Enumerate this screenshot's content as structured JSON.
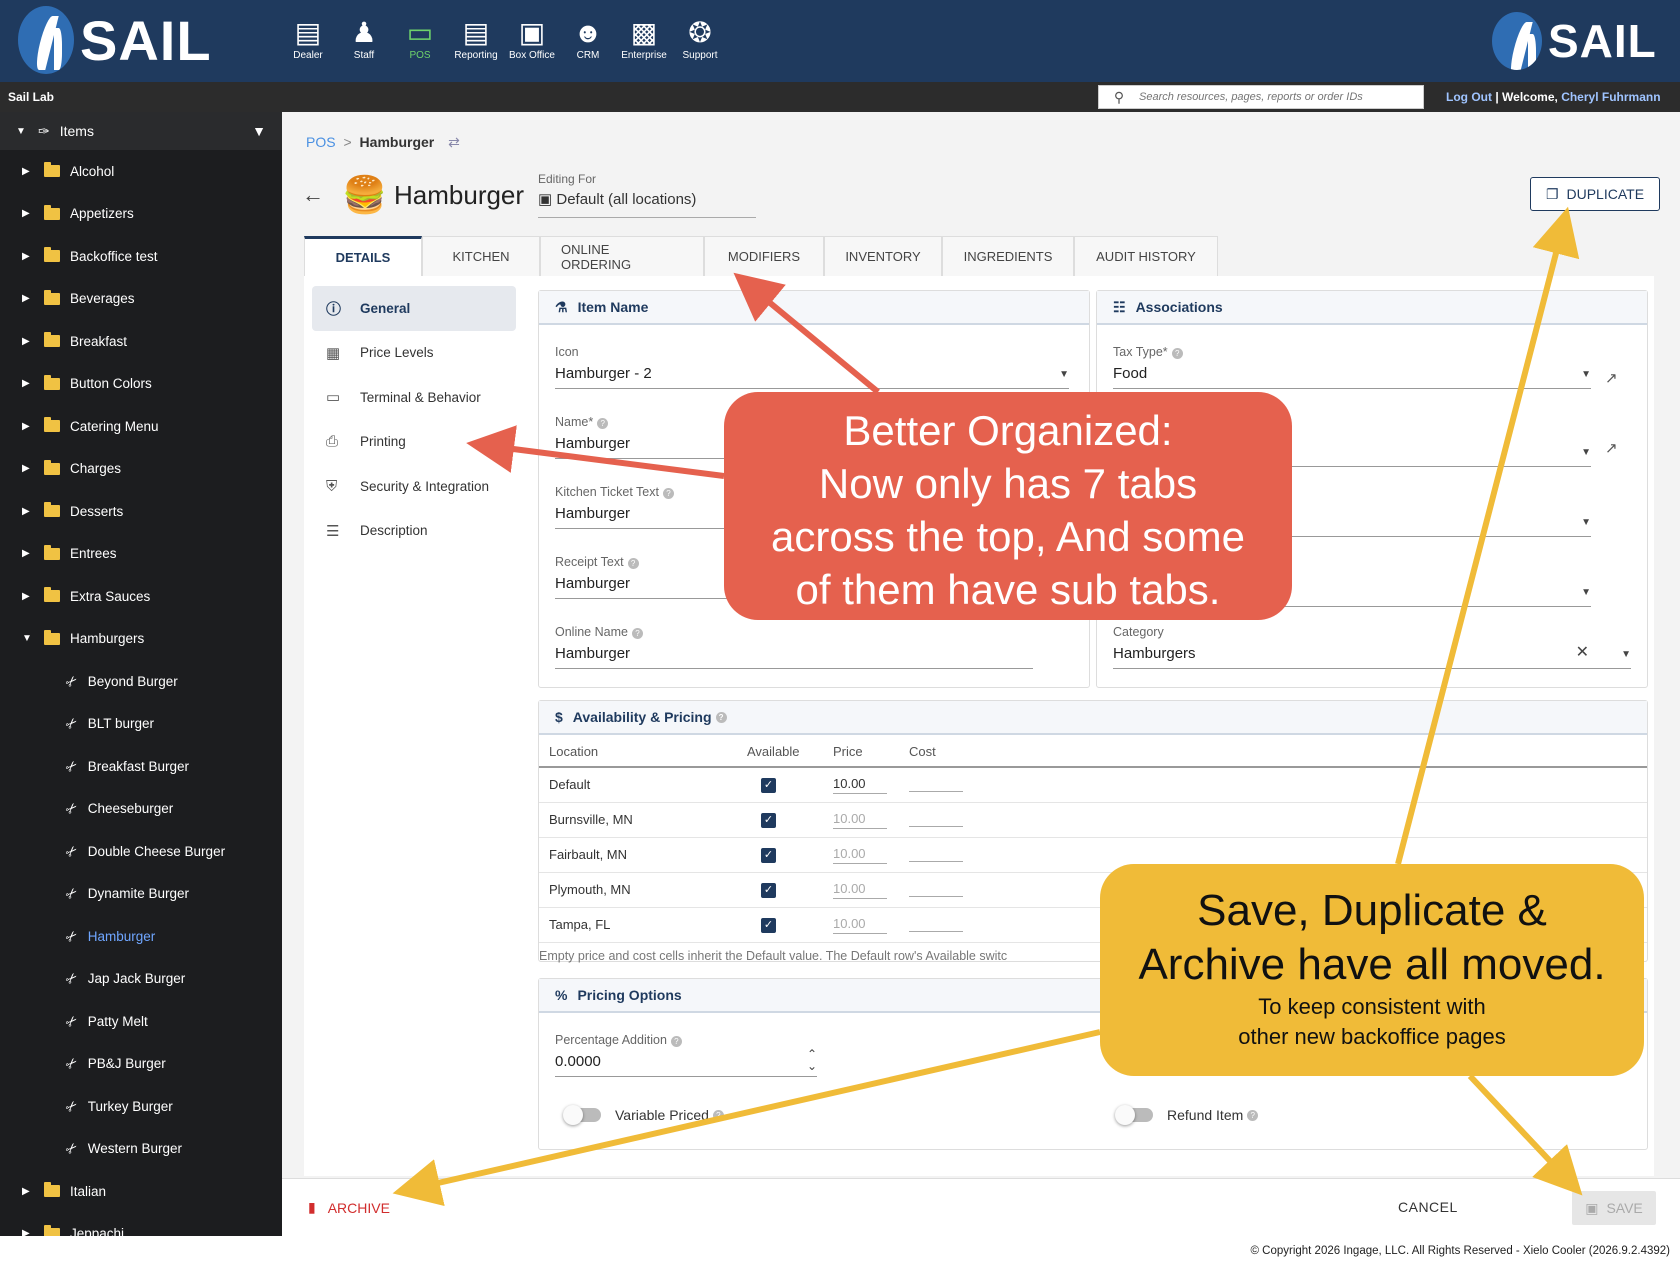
{
  "header": {
    "brand": "SAIL",
    "modules": [
      {
        "label": "Dealer",
        "icon": "dealer-icon"
      },
      {
        "label": "Staff",
        "icon": "staff-icon"
      },
      {
        "label": "POS",
        "icon": "pos-icon",
        "active": true
      },
      {
        "label": "Reporting",
        "icon": "reporting-icon"
      },
      {
        "label": "Box Office",
        "icon": "box-office-icon"
      },
      {
        "label": "CRM",
        "icon": "crm-icon"
      },
      {
        "label": "Enterprise",
        "icon": "enterprise-icon"
      },
      {
        "label": "Support",
        "icon": "support-icon"
      }
    ]
  },
  "subbar": {
    "location": "Sail Lab",
    "search_placeholder": "Search resources, pages, reports or order IDs",
    "logout": "Log Out",
    "welcome": "Welcome,",
    "user": "Cheryl Fuhrmann"
  },
  "sidebar": {
    "root": "Items",
    "items": [
      {
        "label": "Alcohol",
        "type": "folder"
      },
      {
        "label": "Appetizers",
        "type": "folder"
      },
      {
        "label": "Backoffice test",
        "type": "folder"
      },
      {
        "label": "Beverages",
        "type": "folder"
      },
      {
        "label": "Breakfast",
        "type": "folder"
      },
      {
        "label": "Button Colors",
        "type": "folder"
      },
      {
        "label": "Catering Menu",
        "type": "folder"
      },
      {
        "label": "Charges",
        "type": "folder"
      },
      {
        "label": "Desserts",
        "type": "folder"
      },
      {
        "label": "Entrees",
        "type": "folder"
      },
      {
        "label": "Extra Sauces",
        "type": "folder"
      },
      {
        "label": "Hamburgers",
        "type": "folder",
        "open": true
      },
      {
        "label": "Beyond Burger",
        "type": "item"
      },
      {
        "label": "BLT burger",
        "type": "item"
      },
      {
        "label": "Breakfast Burger",
        "type": "item"
      },
      {
        "label": "Cheeseburger",
        "type": "item"
      },
      {
        "label": "Double Cheese Burger",
        "type": "item"
      },
      {
        "label": "Dynamite Burger",
        "type": "item"
      },
      {
        "label": "Hamburger",
        "type": "item",
        "selected": true
      },
      {
        "label": "Jap Jack Burger",
        "type": "item"
      },
      {
        "label": "Patty Melt",
        "type": "item"
      },
      {
        "label": "PB&J Burger",
        "type": "item"
      },
      {
        "label": "Turkey Burger",
        "type": "item"
      },
      {
        "label": "Western Burger",
        "type": "item"
      },
      {
        "label": "Italian",
        "type": "folder"
      },
      {
        "label": "Jeppachi",
        "type": "folder"
      }
    ]
  },
  "breadcrumb": {
    "root": "POS",
    "sep": ">",
    "current": "Hamburger"
  },
  "title": "Hamburger",
  "editing": {
    "label": "Editing For",
    "value": "Default (all locations)"
  },
  "duplicate_label": "DUPLICATE",
  "tabs": [
    "DETAILS",
    "KITCHEN",
    "ONLINE ORDERING",
    "MODIFIERS",
    "INVENTORY",
    "INGREDIENTS",
    "AUDIT HISTORY"
  ],
  "subnav": [
    {
      "label": "General",
      "icon": "info-icon",
      "active": true
    },
    {
      "label": "Price Levels",
      "icon": "price-levels-icon"
    },
    {
      "label": "Terminal & Behavior",
      "icon": "monitor-icon"
    },
    {
      "label": "Printing",
      "icon": "printer-icon"
    },
    {
      "label": "Security & Integration",
      "icon": "shield-icon"
    },
    {
      "label": "Description",
      "icon": "lines-icon"
    }
  ],
  "item_name": {
    "title": "Item Name",
    "icon_label": "Icon",
    "icon_value": "Hamburger - 2",
    "name_label": "Name*",
    "name_value": "Hamburger",
    "kitchen_label": "Kitchen Ticket Text",
    "kitchen_value": "Hamburger",
    "receipt_label": "Receipt Text",
    "receipt_value": "Hamburger",
    "online_label": "Online Name",
    "online_value": "Hamburger"
  },
  "associations": {
    "title": "Associations",
    "tax_label": "Tax Type*",
    "tax_value": "Food",
    "category_label": "Category",
    "category_value": "Hamburgers"
  },
  "availability": {
    "title": "Availability & Pricing",
    "headers": [
      "Location",
      "Available",
      "Price",
      "Cost"
    ],
    "rows": [
      {
        "location": "Default",
        "available": true,
        "price": "10.00",
        "dim": false
      },
      {
        "location": "Burnsville, MN",
        "available": true,
        "price": "10.00",
        "dim": true
      },
      {
        "location": "Fairbault, MN",
        "available": true,
        "price": "10.00",
        "dim": true
      },
      {
        "location": "Plymouth, MN",
        "available": true,
        "price": "10.00",
        "dim": true
      },
      {
        "location": "Tampa, FL",
        "available": true,
        "price": "10.00",
        "dim": true
      }
    ],
    "note": "Empty price and cost cells inherit the Default value. The Default row's Available switc"
  },
  "pricing_options": {
    "title": "Pricing Options",
    "pct_label": "Percentage Addition",
    "pct_value": "0.0000",
    "variable_label": "Variable Priced",
    "refund_label": "Refund Item"
  },
  "footer": {
    "archive": "ARCHIVE",
    "cancel": "CANCEL",
    "save": "SAVE"
  },
  "copyright": "© Copyright 2026 Ingage, LLC. All Rights Reserved - Xielo Cooler (2026.9.2.4392)",
  "callouts": {
    "organized": [
      "Better Organized:",
      "Now only has 7 tabs",
      "across the top, And some",
      "of them have sub tabs."
    ],
    "moved_big": [
      "Save, Duplicate &",
      "Archive have all moved."
    ],
    "moved_small": [
      "To keep consistent with",
      "other new backoffice pages"
    ]
  },
  "colors": {
    "navy": "#1f3a5e",
    "accent_red": "#e5614e",
    "accent_yellow": "#f0bb38",
    "pos_active": "#6ed36b"
  }
}
